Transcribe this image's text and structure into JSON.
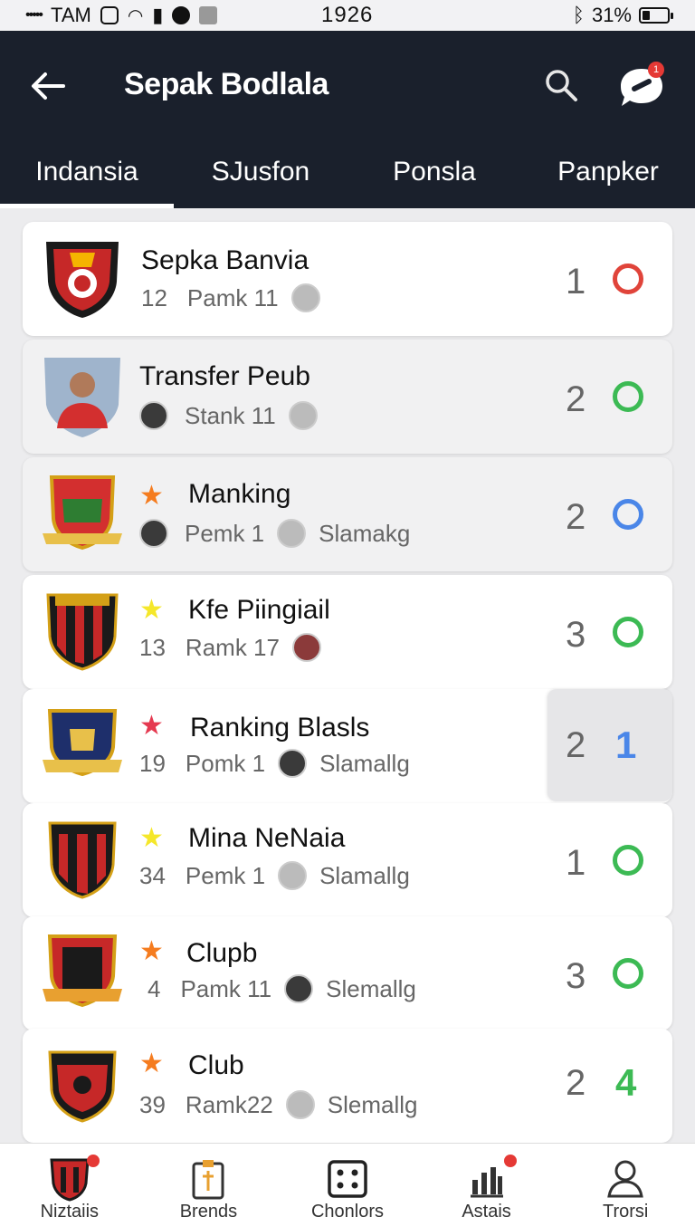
{
  "status_bar": {
    "signal": "•••••",
    "carrier": "TAM",
    "time": "1926",
    "battery": "31%",
    "battery_level": 0.31
  },
  "app_bar": {
    "back_icon": "arrow-left-icon",
    "title": "Sepak Bodlala",
    "search_icon": "search-icon",
    "chat_icon": "chat-bubble-icon",
    "chat_badge": "1"
  },
  "tabs": [
    {
      "label": "Indansia",
      "active": true
    },
    {
      "label": "SJusfon",
      "active": false
    },
    {
      "label": "Ponsla",
      "active": false
    },
    {
      "label": "Panpker",
      "active": false
    }
  ],
  "items": [
    {
      "name": "Sepka Banvia",
      "num": "12",
      "pos": "Pamk 11",
      "extra": "",
      "star": "",
      "rank": "1",
      "indicator": "circle",
      "indicator_color": "#e0443a",
      "indicator_value": ""
    },
    {
      "name": "Transfer Peub",
      "num": "",
      "pos": "Stank 11",
      "extra": "",
      "star": "",
      "rank": "2",
      "indicator": "circle",
      "indicator_color": "#3cba54",
      "indicator_value": ""
    },
    {
      "name": "Manking",
      "num": "",
      "pos": "Pemk 1",
      "extra": "Slamakg",
      "star": "★",
      "star_color": "#f57c1f",
      "rank": "2",
      "indicator": "circle",
      "indicator_color": "#4a86e8",
      "indicator_value": ""
    },
    {
      "name": "Kfe Piingiail",
      "num": "13",
      "pos": "Ramk 17",
      "extra": "",
      "star": "★",
      "star_color": "#f5e72a",
      "rank": "3",
      "indicator": "circle",
      "indicator_color": "#3cba54",
      "indicator_value": ""
    },
    {
      "name": "Ranking Blasls",
      "num": "19",
      "pos": "Pomk 1",
      "extra": "Slamallg",
      "star": "★",
      "star_color": "#e53950",
      "rank": "2",
      "indicator": "number",
      "indicator_color": "#4a86e8",
      "indicator_value": "1"
    },
    {
      "name": "Mina NeNaia",
      "num": "34",
      "pos": "Pemk 1",
      "extra": "Slamallg",
      "star": "★",
      "star_color": "#f5e72a",
      "rank": "1",
      "indicator": "circle",
      "indicator_color": "#3cba54",
      "indicator_value": ""
    },
    {
      "name": "Clupb",
      "num": "4",
      "pos": "Pamk 11",
      "extra": "Slemallg",
      "star": "★",
      "star_color": "#f57c1f",
      "rank": "3",
      "indicator": "circle",
      "indicator_color": "#3cba54",
      "indicator_value": ""
    },
    {
      "name": "Club",
      "num": "39",
      "pos": "Ramk22",
      "extra": "Slemallg",
      "star": "★",
      "star_color": "#f57c1f",
      "rank": "2",
      "indicator": "number",
      "indicator_color": "#3cba54",
      "indicator_value": "4"
    }
  ],
  "bottom_nav": [
    {
      "label": "Niztajis",
      "icon": "club-crest-icon",
      "badge": true
    },
    {
      "label": "Brends",
      "icon": "clipboard-icon",
      "badge": false
    },
    {
      "label": "Chonlors",
      "icon": "dice-icon",
      "badge": false
    },
    {
      "label": "Astais",
      "icon": "bar-chart-icon",
      "badge": true
    },
    {
      "label": "Trorsi",
      "icon": "profile-icon",
      "badge": false
    }
  ]
}
